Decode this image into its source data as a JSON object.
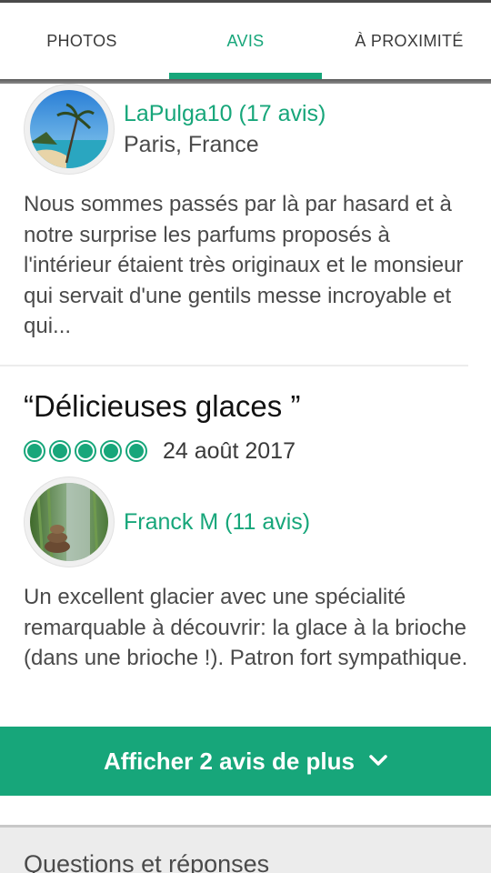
{
  "tabs": [
    {
      "label": "PHOTOS",
      "active": false
    },
    {
      "label": "AVIS",
      "active": true
    },
    {
      "label": "À PROXIMITÉ",
      "active": false
    }
  ],
  "review1": {
    "username": "LaPulga10 (17 avis)",
    "location": "Paris, France",
    "text": "Nous sommes passés par là par hasard et à notre surprise les parfums proposés à l'intérieur étaient très originaux et le monsieur qui servait d'une gentils messe incroyable et qui..."
  },
  "review2": {
    "title": "“Délicieuses glaces ”",
    "rating": 5,
    "rating_max": 5,
    "date": "24 août 2017",
    "username": "Franck M (11 avis)",
    "text": "Un excellent glacier avec une spécialité remarquable à découvrir: la glace à la brioche (dans une brioche !). Patron fort sympathique."
  },
  "more_button": {
    "label": "Afficher 2 avis de plus",
    "icon": "chevron-down-icon"
  },
  "qa": {
    "title": "Questions et réponses"
  },
  "colors": {
    "accent": "#17a67a",
    "text": "#4a4a4a"
  }
}
